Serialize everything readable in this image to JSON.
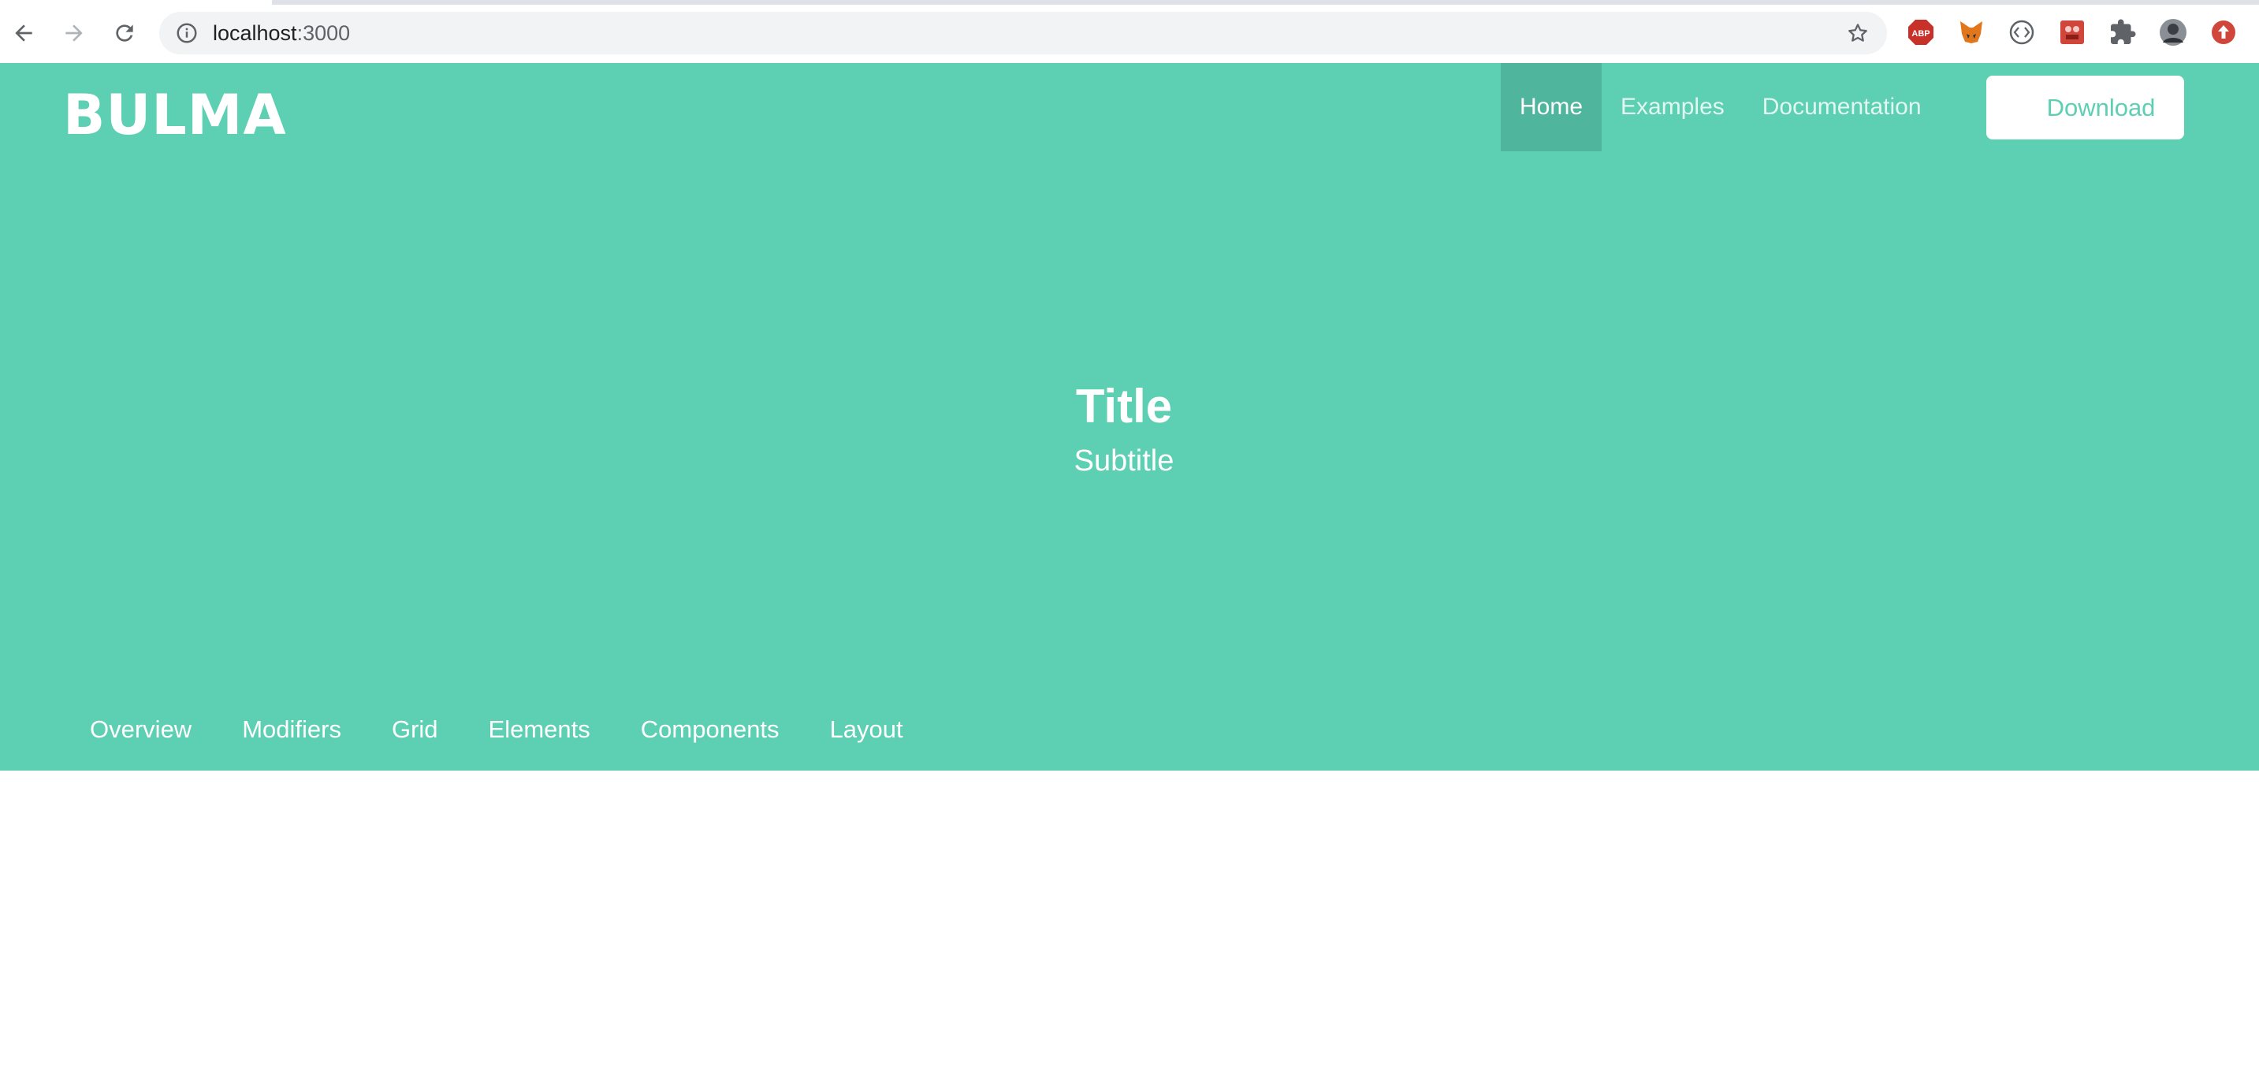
{
  "browser": {
    "url_host": "localhost",
    "url_port": ":3000",
    "extensions": [
      "adblock-icon",
      "metamask-fox-icon",
      "code-brackets-icon",
      "red-extension-icon",
      "puzzle-piece-icon",
      "profile-avatar",
      "update-icon"
    ]
  },
  "navbar": {
    "brand": "BULMA",
    "items": [
      {
        "label": "Home",
        "active": true
      },
      {
        "label": "Examples",
        "active": false
      },
      {
        "label": "Documentation",
        "active": false
      }
    ],
    "download_label": "Download"
  },
  "hero": {
    "title": "Title",
    "subtitle": "Subtitle"
  },
  "tabs": [
    {
      "label": "Overview"
    },
    {
      "label": "Modifiers"
    },
    {
      "label": "Grid"
    },
    {
      "label": "Elements"
    },
    {
      "label": "Components"
    },
    {
      "label": "Layout"
    }
  ],
  "colors": {
    "primary": "#5dcfb2",
    "active_nav": "#4fb69d",
    "white": "#ffffff"
  }
}
